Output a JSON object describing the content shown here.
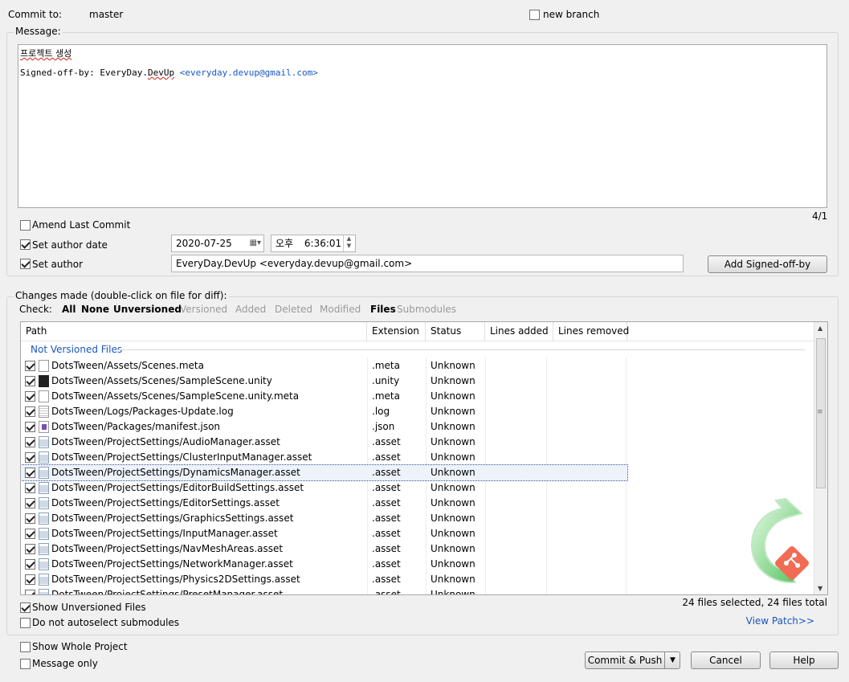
{
  "commit": {
    "label": "Commit to:",
    "branch": "master",
    "new_branch_label": "new branch"
  },
  "message": {
    "group_label": "Message:",
    "line1": "프로젝트 생성",
    "signoff_prefix": "Signed-off-by: EveryDay.",
    "signoff_name_squiggle": "DevUp",
    "signoff_email": "<everyday.devup@gmail.com>",
    "counter": "4/1"
  },
  "options": {
    "amend_label": "Amend Last Commit",
    "set_author_date_label": "Set author date",
    "date_value": "2020-07-25",
    "time_ampm": "오후",
    "time_value": "6:36:01",
    "set_author_label": "Set author",
    "author_value": "EveryDay.DevUp <everyday.devup@gmail.com>",
    "add_signoff_button": "Add Signed-off-by"
  },
  "changes": {
    "group_label": "Changes made (double-click on file for diff):",
    "check_label": "Check:",
    "filters": [
      {
        "label": "All",
        "active": true
      },
      {
        "label": "None",
        "active": true
      },
      {
        "label": "Unversioned",
        "active": true
      },
      {
        "label": "Versioned",
        "active": false
      },
      {
        "label": "Added",
        "active": false
      },
      {
        "label": "Deleted",
        "active": false
      },
      {
        "label": "Modified",
        "active": false
      },
      {
        "label": "Files",
        "active": true
      },
      {
        "label": "Submodules",
        "active": false
      }
    ],
    "columns": [
      "Path",
      "Extension",
      "Status",
      "Lines added",
      "Lines removed"
    ],
    "section_title": "Not Versioned Files",
    "files": [
      {
        "path": "DotsTween/Assets/Scenes.meta",
        "ext": ".meta",
        "status": "Unknown",
        "icon": "doc"
      },
      {
        "path": "DotsTween/Assets/Scenes/SampleScene.unity",
        "ext": ".unity",
        "status": "Unknown",
        "icon": "unity"
      },
      {
        "path": "DotsTween/Assets/Scenes/SampleScene.unity.meta",
        "ext": ".meta",
        "status": "Unknown",
        "icon": "doc"
      },
      {
        "path": "DotsTween/Logs/Packages-Update.log",
        "ext": ".log",
        "status": "Unknown",
        "icon": "log"
      },
      {
        "path": "DotsTween/Packages/manifest.json",
        "ext": ".json",
        "status": "Unknown",
        "icon": "json"
      },
      {
        "path": "DotsTween/ProjectSettings/AudioManager.asset",
        "ext": ".asset",
        "status": "Unknown",
        "icon": "asset"
      },
      {
        "path": "DotsTween/ProjectSettings/ClusterInputManager.asset",
        "ext": ".asset",
        "status": "Unknown",
        "icon": "asset"
      },
      {
        "path": "DotsTween/ProjectSettings/DynamicsManager.asset",
        "ext": ".asset",
        "status": "Unknown",
        "icon": "asset",
        "selected": true
      },
      {
        "path": "DotsTween/ProjectSettings/EditorBuildSettings.asset",
        "ext": ".asset",
        "status": "Unknown",
        "icon": "asset"
      },
      {
        "path": "DotsTween/ProjectSettings/EditorSettings.asset",
        "ext": ".asset",
        "status": "Unknown",
        "icon": "asset"
      },
      {
        "path": "DotsTween/ProjectSettings/GraphicsSettings.asset",
        "ext": ".asset",
        "status": "Unknown",
        "icon": "asset"
      },
      {
        "path": "DotsTween/ProjectSettings/InputManager.asset",
        "ext": ".asset",
        "status": "Unknown",
        "icon": "asset"
      },
      {
        "path": "DotsTween/ProjectSettings/NavMeshAreas.asset",
        "ext": ".asset",
        "status": "Unknown",
        "icon": "asset"
      },
      {
        "path": "DotsTween/ProjectSettings/NetworkManager.asset",
        "ext": ".asset",
        "status": "Unknown",
        "icon": "asset"
      },
      {
        "path": "DotsTween/ProjectSettings/Physics2DSettings.asset",
        "ext": ".asset",
        "status": "Unknown",
        "icon": "asset"
      },
      {
        "path": "DotsTween/ProjectSettings/PresetManager.asset",
        "ext": ".asset",
        "status": "Unknown",
        "icon": "asset"
      }
    ],
    "show_unversioned_label": "Show Unversioned Files",
    "no_autoselect_label": "Do not autoselect submodules",
    "summary": "24 files selected, 24 files total",
    "view_patch": "View Patch>>"
  },
  "bottom": {
    "show_whole_project": "Show Whole Project",
    "message_only": "Message only",
    "commit_push_button": "Commit & Push",
    "cancel_button": "Cancel",
    "help_button": "Help"
  },
  "colors": {
    "accent_link": "#1a56c0",
    "watermark_green": "#5ec86a",
    "git_logo": "#f05033"
  }
}
